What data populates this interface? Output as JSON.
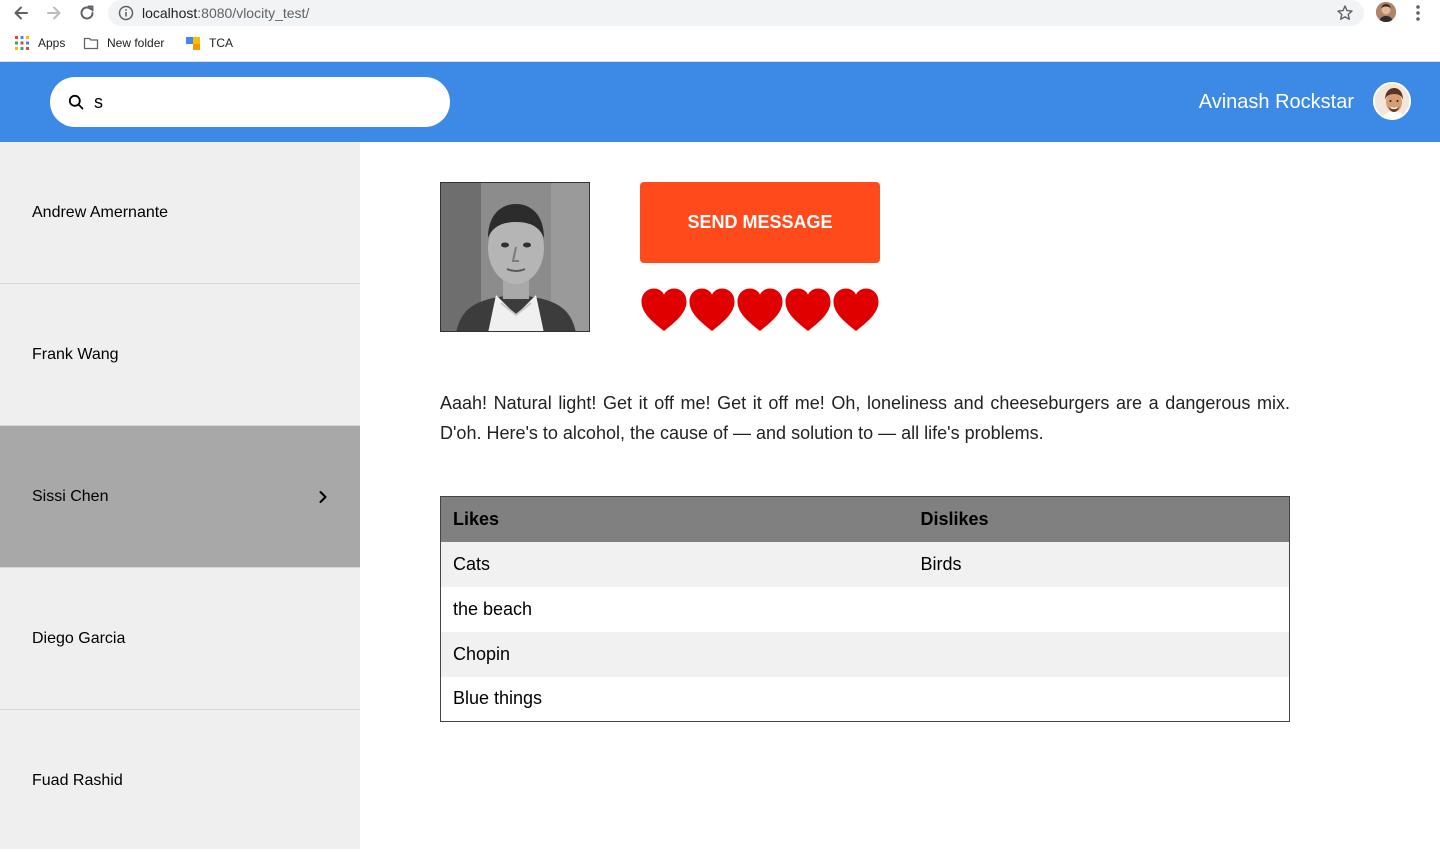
{
  "browser": {
    "url_host": "localhost",
    "url_rest": ":8080/vlocity_test/",
    "bookmarks": [
      {
        "label": "Apps",
        "icon": "apps-grid-icon"
      },
      {
        "label": "New folder",
        "icon": "folder-icon"
      },
      {
        "label": "TCA",
        "icon": "tca-favicon-icon"
      }
    ]
  },
  "header": {
    "search_value": "s",
    "user_name": "Avinash Rockstar",
    "accent_color": "#3d8ae6"
  },
  "sidebar": {
    "items": [
      {
        "label": "Andrew Amernante"
      },
      {
        "label": "Frank Wang"
      },
      {
        "label": "Sissi Chen"
      },
      {
        "label": "Diego Garcia"
      },
      {
        "label": "Fuad Rashid"
      }
    ],
    "active_index": 2
  },
  "profile": {
    "send_button_label": "SEND MESSAGE",
    "send_button_color": "#ff4a1c",
    "rating": 5,
    "rating_max": 5,
    "heart_color": "#e00000",
    "bio": "Aaah! Natural light! Get it off me! Get it off me! Oh, loneliness and cheeseburgers are a dangerous mix. D'oh. Here's to alcohol, the cause of — and solution to — all life's problems."
  },
  "table": {
    "headers": [
      "Likes",
      "Dislikes"
    ],
    "rows": [
      [
        "Cats",
        "Birds"
      ],
      [
        "the beach",
        ""
      ],
      [
        "Chopin",
        ""
      ],
      [
        "Blue things",
        ""
      ]
    ]
  }
}
